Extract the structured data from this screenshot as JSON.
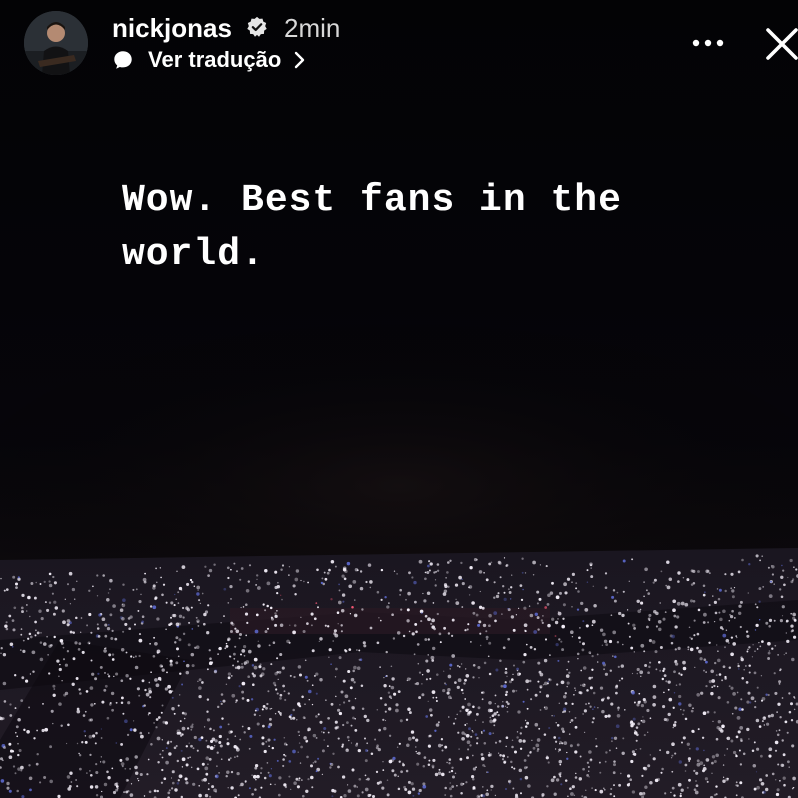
{
  "story": {
    "user": {
      "username": "nickjonas",
      "verified": true,
      "timestamp": "2min",
      "avatar_icon": "profile-avatar-icon"
    },
    "translate": {
      "label": "Ver tradução",
      "icon": "chat-bubble-icon",
      "chevron_icon": "chevron-right-icon"
    },
    "actions": {
      "more_icon": "more-options-icon",
      "close_icon": "close-icon"
    },
    "caption": "Wow. Best fans in the world.",
    "colors": {
      "background": "#040406",
      "text": "#ffffff",
      "timestamp": "#d8d8d8",
      "phone_lights": "#f3eef8",
      "stage_glow": "#ff5a78",
      "crowd_tint": "#5a66c8"
    }
  }
}
